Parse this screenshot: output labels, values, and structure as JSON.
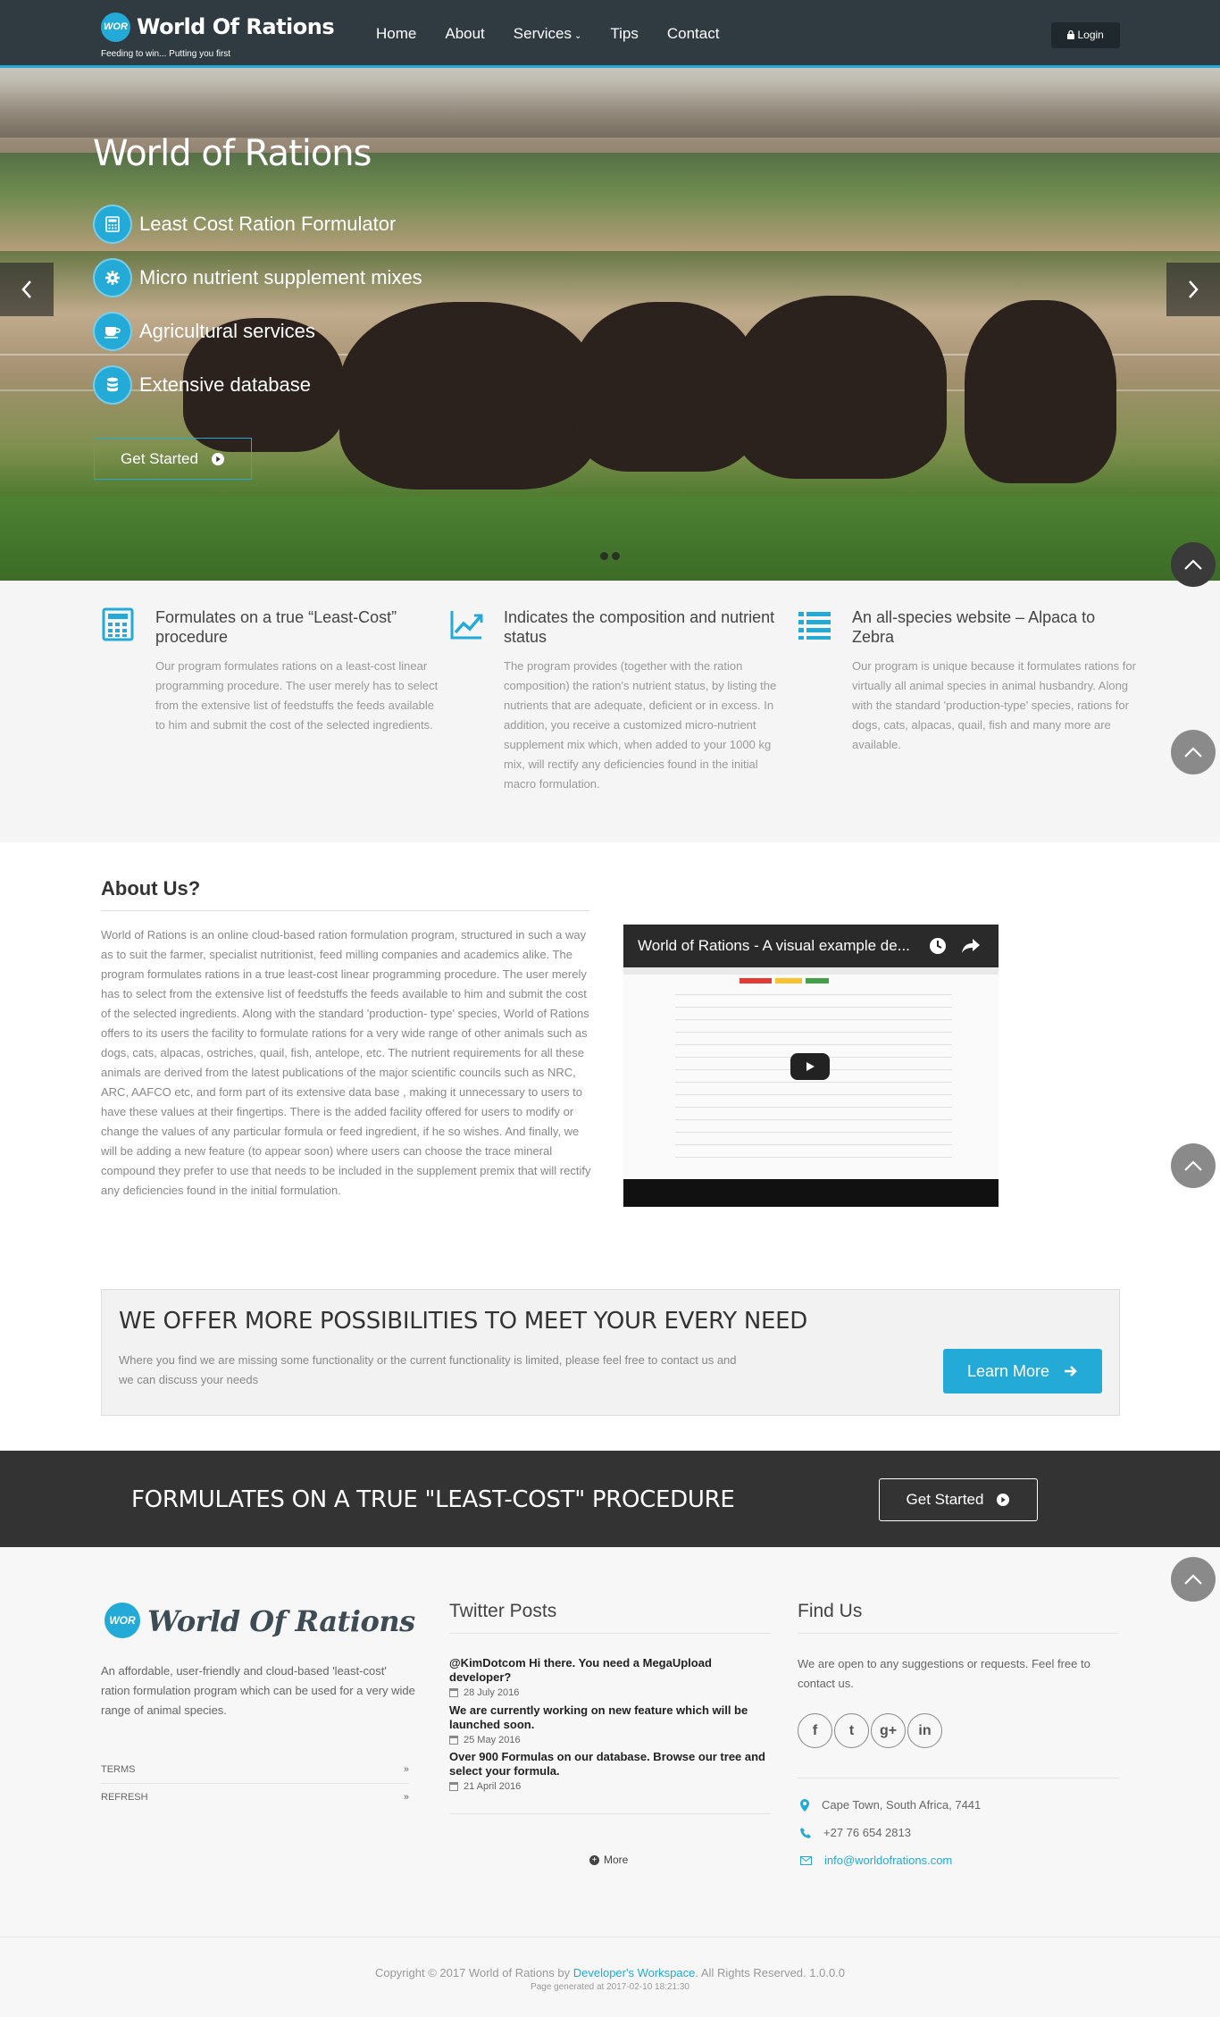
{
  "brand": {
    "logo_badge": "WOR",
    "name": "World Of Rations",
    "tagline": "Feeding to win... Putting you first"
  },
  "nav": {
    "items": [
      "Home",
      "About",
      "Services",
      "Tips",
      "Contact"
    ],
    "services_caret": "⌄",
    "login": "Login"
  },
  "hero": {
    "title": "World of Rations",
    "items": [
      {
        "icon": "calculator-icon",
        "label": "Least Cost Ration Formulator"
      },
      {
        "icon": "gear-icon",
        "label": "Micro nutrient supplement mixes"
      },
      {
        "icon": "coffee-icon",
        "label": "Agricultural services"
      },
      {
        "icon": "database-icon",
        "label": "Extensive database"
      }
    ],
    "cta": "Get Started",
    "slide_count": 2
  },
  "features": [
    {
      "icon": "calculator-icon",
      "title": "Formulates on a true “Least-Cost” procedure",
      "text": "Our program formulates rations on a least-cost linear programming procedure. The user merely has to select from the extensive list of feedstuffs the feeds available to him and submit the cost of the selected ingredients."
    },
    {
      "icon": "line-chart-icon",
      "title": "Indicates the composition and nutrient status",
      "text": "The program provides (together with the ration composition) the ration's nutrient status, by listing the nutrients that are adequate, deficient or in excess. In addition, you receive a customized micro-nutrient supplement mix which, when added to your 1000 kg mix, will rectify any deficiencies found in the initial macro formulation."
    },
    {
      "icon": "list-icon",
      "title": "An all-species website – Alpaca to Zebra",
      "text": "Our program is unique because it formulates rations for virtually all animal species in animal husbandry. Along with the standard 'production-type' species, rations for dogs, cats, alpacas, quail, fish and many more are available."
    }
  ],
  "about": {
    "heading_pre": "About ",
    "heading_bold": "Us?",
    "text": "World of Rations is an online cloud-based ration formulation program, structured in such a way as to suit the farmer, specialist nutritionist, feed milling companies and academics alike. The program formulates rations in a true least-cost linear programming procedure. The user merely has to select from the extensive list of feedstuffs the feeds available to him and submit the cost of the selected ingredients. Along with the standard 'production- type' species, World of Rations offers to its users the facility to formulate rations for a very wide range of other animals such as dogs, cats, alpacas, ostriches, quail, fish, antelope, etc. The nutrient requirements for all these animals are derived from the latest publications of the major scientific councils such as NRC, ARC, AAFCO etc, and form part of its extensive data base , making it unnecessary to users to have these values at their fingertips. There is the added facility offered for users to modify or change the values of any particular formula or feed ingredient, if he so wishes. And finally, we will be adding a new feature (to appear soon) where users can choose the trace mineral compound they prefer to use that needs to be included in the supplement premix that will rectify any deficiencies found in the initial formulation.",
    "video_title": "World of Rations - A visual example de..."
  },
  "offer": {
    "heading": "WE OFFER MORE POSSIBILITIES TO MEET YOUR EVERY NEED",
    "text": "Where you find we are missing some functionality or the current functionality is limited, please feel free to contact us and we can discuss your needs",
    "button": "Learn More"
  },
  "band": {
    "heading": "FORMULATES ON A TRUE \"LEAST-COST\" PROCEDURE",
    "button": "Get Started"
  },
  "footer": {
    "description": "An affordable, user-friendly and cloud-based 'least-cost' ration formulation program which can be used for a very wide range of animal species.",
    "links": [
      "Terms",
      "Refresh"
    ],
    "link_arrow": "»",
    "twitter_heading": "Twitter Posts",
    "tweets": [
      {
        "text": "@KimDotcom Hi there. You need a MegaUpload developer?",
        "date": "28 July 2016"
      },
      {
        "text": "We are currently working on new feature which will be launched soon.",
        "date": "25 May 2016"
      },
      {
        "text": "Over 900 Formulas on our database. Browse our tree and select your formula.",
        "date": "21 April 2016"
      }
    ],
    "more": "More",
    "find_heading": "Find Us",
    "find_text": "We are open to any suggestions or requests. Feel free to contact us.",
    "social": [
      "f",
      "t",
      "g+",
      "in"
    ],
    "address": "Cape Town, South Africa, 7441",
    "phone": "+27 76 654 2813",
    "email": "info@worldofrations.com"
  },
  "copyright": {
    "pre": "Copyright © 2017 World of Rations by ",
    "link": "Developer's Workspace",
    "post": ". All Rights Reserved. 1.0.0.0",
    "generated": "Page generated at 2017-02-10 18:21:30"
  },
  "colors": {
    "accent": "#23aad6",
    "nav_bg": "#2f3a41",
    "band_bg": "#333333"
  }
}
